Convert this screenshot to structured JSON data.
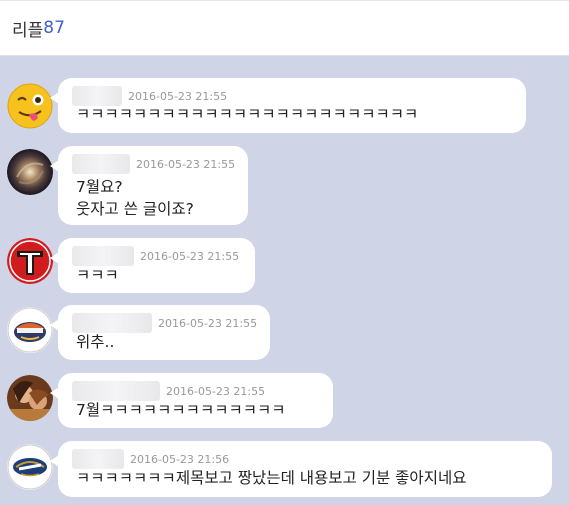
{
  "header": {
    "title": "리플",
    "count": "87"
  },
  "comments": [
    {
      "time": "2016-05-23 21:55",
      "lines": [
        "ㅋㅋㅋㅋㅋㅋㅋㅋㅋㅋㅋㅋㅋㅋㅋㅋㅋㅋㅋㅋㅋㅋㅋㅋ"
      ],
      "avatar": "winking-emoji-icon"
    },
    {
      "time": "2016-05-23 21:55",
      "lines": [
        "7월요?",
        "웃자고 쓴 글이죠?"
      ],
      "avatar": "galaxy-avatar"
    },
    {
      "time": "2016-05-23 21:55",
      "lines": [
        "ㅋㅋㅋ"
      ],
      "avatar": "red-team-logo-avatar"
    },
    {
      "time": "2016-05-23 21:55",
      "lines": [
        "위추.."
      ],
      "avatar": "team-logo-avatar"
    },
    {
      "time": "2016-05-23 21:55",
      "lines": [
        "7월ㅋㅋㅋㅋㅋㅋㅋㅋㅋㅋㅋㅋㅋ"
      ],
      "avatar": "photo-avatar"
    },
    {
      "time": "2016-05-23 21:56",
      "lines": [
        "ㅋㅋㅋㅋㅋㅋㅋ제목보고 짱났는데 내용보고 기분 좋아지네요"
      ],
      "avatar": "brewers-logo-avatar"
    }
  ]
}
